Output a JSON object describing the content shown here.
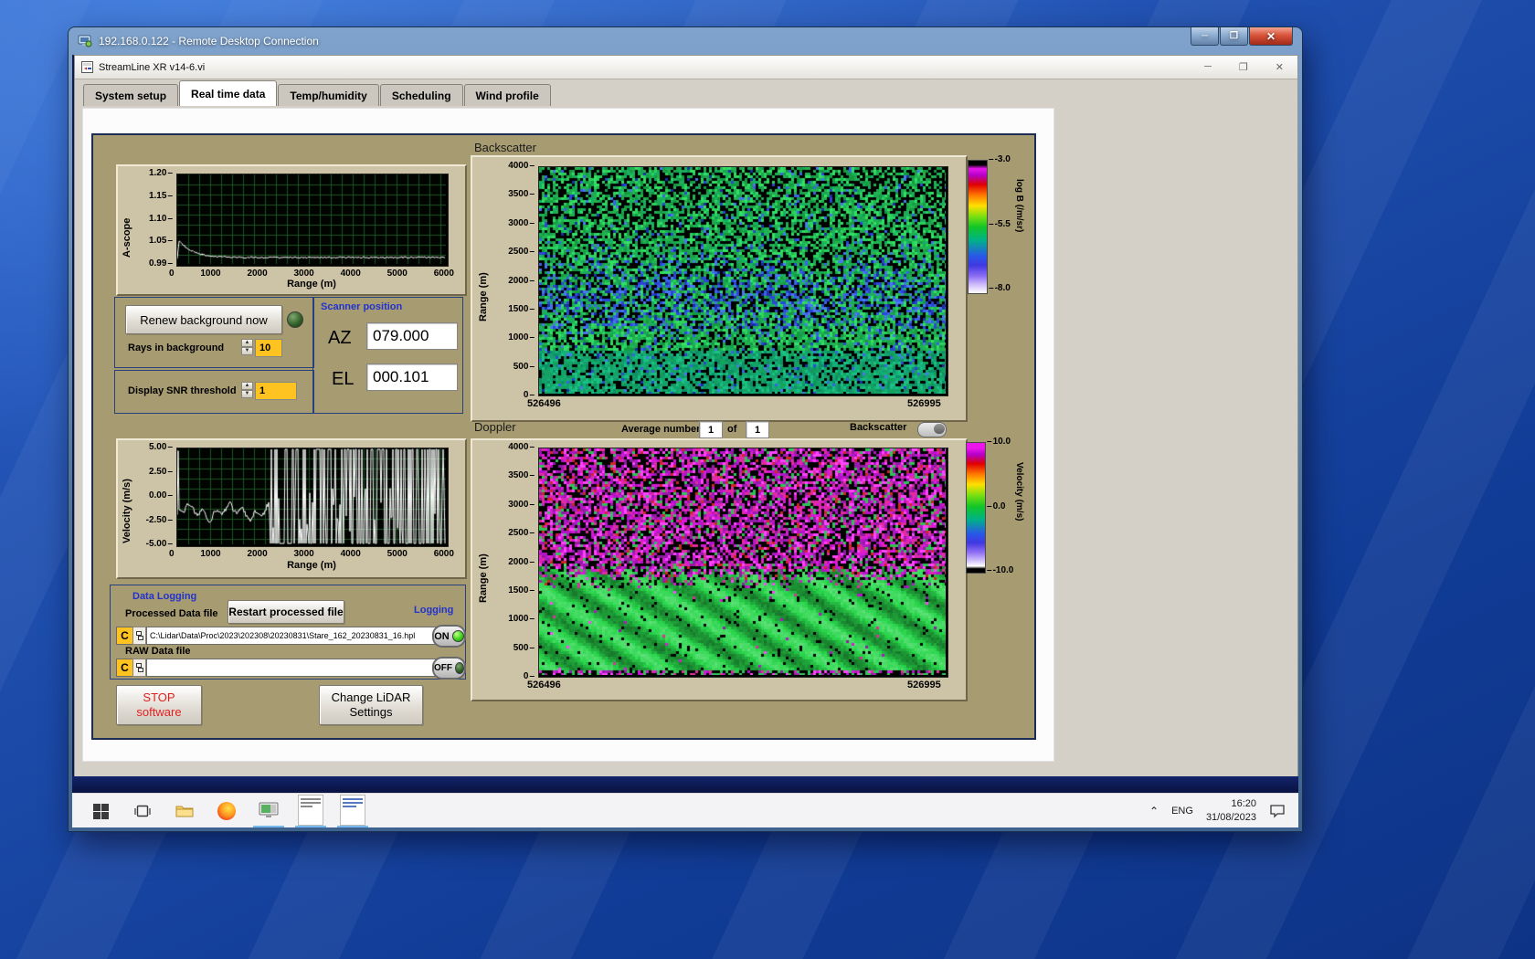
{
  "window": {
    "rdp_title": "192.168.0.122 - Remote Desktop Connection",
    "min_glyph": "─",
    "restore_glyph": "❐",
    "close_glyph": "✕"
  },
  "app": {
    "title": "StreamLine XR v14-6.vi",
    "min_glyph": "─",
    "restore_glyph": "❐",
    "close_glyph": "✕",
    "tabs": [
      "System setup",
      "Real time data",
      "Temp/humidity",
      "Scheduling",
      "Wind profile"
    ],
    "active_tab": "Real time data"
  },
  "ascope": {
    "ylabel": "A-scope",
    "xlabel": "Range (m)",
    "yticks": [
      "1.20",
      "1.15",
      "1.10",
      "1.05",
      "0.99"
    ],
    "xticks": [
      "0",
      "1000",
      "2000",
      "3000",
      "4000",
      "5000",
      "6000"
    ]
  },
  "controls": {
    "renew_button": "Renew background now",
    "rays_label": "Rays in background",
    "rays_value": "10",
    "snr_label": "Display SNR threshold",
    "snr_value": "1"
  },
  "scanner": {
    "title": "Scanner position",
    "az_label": "AZ",
    "az_value": "079.000",
    "el_label": "EL",
    "el_value": "000.101"
  },
  "velocity": {
    "ylabel": "Velocity (m/s)",
    "xlabel": "Range (m)",
    "yticks": [
      "5.00",
      "2.50",
      "0.00",
      "-2.50",
      "-5.00"
    ],
    "xticks": [
      "0",
      "1000",
      "2000",
      "3000",
      "4000",
      "5000",
      "6000"
    ]
  },
  "backscatter": {
    "title": "Backscatter",
    "ylabel": "Range (m)",
    "yticks": [
      "4000",
      "3500",
      "3000",
      "2500",
      "2000",
      "1500",
      "1000",
      "500",
      "0"
    ],
    "x_start": "526496",
    "x_end": "526995",
    "colorbar": {
      "label": "log B (/m/sr)",
      "ticks": [
        "-3.0",
        "-5.5",
        "-8.0"
      ]
    }
  },
  "doppler": {
    "title": "Doppler",
    "ylabel": "Range (m)",
    "avg_label": "Average number",
    "avg_value": "1",
    "of_label": "of",
    "avg_total": "1",
    "toggle_label": "Backscatter",
    "yticks": [
      "4000",
      "3500",
      "3000",
      "2500",
      "2000",
      "1500",
      "1000",
      "500",
      "0"
    ],
    "x_start": "526496",
    "x_end": "526995",
    "colorbar": {
      "label": "Velocity (m/s)",
      "ticks": [
        "10.0",
        "0.0",
        "-10.0"
      ]
    }
  },
  "logging": {
    "title": "Data Logging",
    "processed_label": "Processed Data file",
    "restart_button": "Restart processed file",
    "logging_label": "Logging",
    "drive": "C",
    "processed_path": "C:\\Lidar\\Data\\Proc\\2023\\202308\\20230831\\Stare_162_20230831_16.hpl",
    "on_label": "ON",
    "raw_label": "RAW Data file",
    "raw_path": "",
    "off_label": "OFF"
  },
  "actions": {
    "stop_line1": "STOP",
    "stop_line2": "software",
    "change_line1": "Change LiDAR",
    "change_line2": "Settings"
  },
  "taskbar": {
    "chevron": "⌃",
    "lang": "ENG",
    "time": "16:20",
    "date": "31/08/2023"
  },
  "colors": {
    "panel_tan": "#a79b72",
    "group_border": "#26407e",
    "label_blue": "#2233cc",
    "value_orange": "#ffc321",
    "led_on": "#3bd215",
    "rdp_titlebar": "#4e739d",
    "taskbar_bg": "#f3f2f4",
    "wallpaper_blue": "#1d4cab"
  },
  "palettes": {
    "scope_grid": "#1c5424",
    "scope_trace": "#f8f8f8",
    "back_greens": [
      "#21b44e",
      "#2bd35d",
      "#149a42",
      "#33e066",
      "#1da44f",
      "#18b060"
    ],
    "back_blues": [
      "#2b46d8",
      "#3a62e8",
      "#1b2fa6",
      "#4878f0"
    ],
    "back_teals": [
      "#16a06e",
      "#12b078",
      "#0e9066",
      "#1bc083",
      "#13a35c"
    ],
    "dop_magentas": [
      "#d81ad8",
      "#b414c8",
      "#ff44ff",
      "#921ca6",
      "#e02ca0"
    ],
    "dop_red": "#d22626",
    "dop_green_speck": "#2ec455",
    "dop_green_hue": 132
  }
}
